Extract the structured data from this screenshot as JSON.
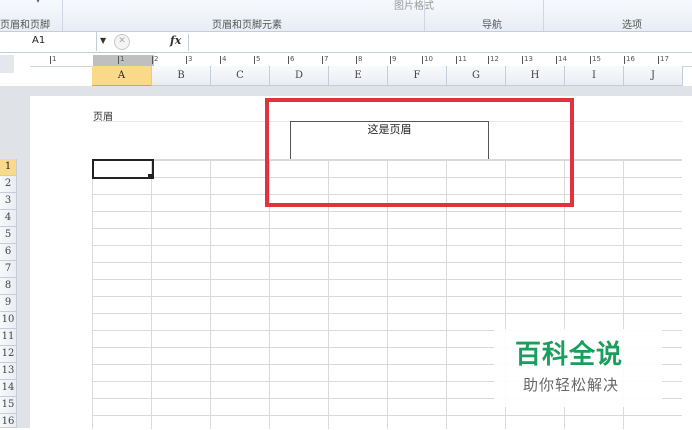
{
  "ribbon": {
    "groups": [
      {
        "label": "页眉和页脚"
      },
      {
        "label": "页眉和页脚元素"
      },
      {
        "label": "导航"
      },
      {
        "label": "选项"
      }
    ],
    "faint_label": "图片格式"
  },
  "formula_bar": {
    "name_box": "A1",
    "fx": "fx",
    "value": ""
  },
  "ruler": {
    "ticks": [
      "1",
      "1",
      "2",
      "3",
      "4",
      "5",
      "6",
      "7",
      "8",
      "9",
      "10",
      "11",
      "12",
      "13",
      "14",
      "15",
      "16",
      "17"
    ]
  },
  "columns": [
    "A",
    "B",
    "C",
    "D",
    "E",
    "F",
    "G",
    "H",
    "I",
    "J"
  ],
  "selected_column": "A",
  "rows": [
    "1",
    "2",
    "3",
    "4",
    "5",
    "6",
    "7",
    "8",
    "9",
    "10",
    "11",
    "12",
    "13",
    "14",
    "15",
    "16"
  ],
  "selected_row": "1",
  "page": {
    "header_label": "页眉",
    "header_text": "这是页眉"
  },
  "watermark": {
    "title": "百科全说",
    "subtitle": "助你轻松解决"
  },
  "colors": {
    "highlight": "#e0333b",
    "selected_header": "#fbd98a",
    "watermark_green": "#1a9e5e"
  }
}
